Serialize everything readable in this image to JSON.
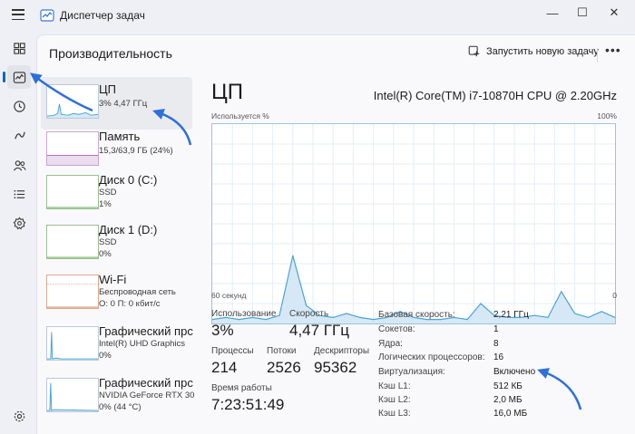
{
  "window": {
    "title": "Диспетчер задач",
    "minimize": "—",
    "maximize": "☐",
    "close": "✕"
  },
  "header": {
    "page_title": "Производительность",
    "run_task_label": "Запустить новую задачу",
    "more_label": "•••"
  },
  "nav": [
    "menu-icon",
    "processes-icon",
    "performance-icon",
    "app-history-icon",
    "startup-icon",
    "users-icon",
    "details-icon",
    "services-icon",
    "settings-icon"
  ],
  "resources": [
    {
      "name": "ЦП",
      "line1": "3% 4,47 ГГц",
      "line2": ""
    },
    {
      "name": "Память",
      "line1": "15,3/63,9 ГБ (24%)",
      "line2": ""
    },
    {
      "name": "Диск 0 (C:)",
      "line1": "SSD",
      "line2": "1%"
    },
    {
      "name": "Диск 1 (D:)",
      "line1": "SSD",
      "line2": "0%"
    },
    {
      "name": "Wi-Fi",
      "line1": "Беспроводная сеть",
      "line2": "О: 0 П: 0 кбит/с"
    },
    {
      "name": "Графический прс",
      "line1": "Intel(R) UHD Graphics",
      "line2": "0%"
    },
    {
      "name": "Графический прс",
      "line1": "NVIDIA GeForce RTX 30",
      "line2": "0% (44 °C)"
    }
  ],
  "cpu": {
    "title": "ЦП",
    "model": "Intel(R) Core(TM) i7-10870H CPU @ 2.20GHz",
    "usage_axis_label": "Используется %",
    "max_label": "100%",
    "time_label": "60 секунд",
    "min_label": "0"
  },
  "chart_data": {
    "type": "area",
    "x": [
      0,
      2,
      4,
      6,
      8,
      10,
      12,
      14,
      16,
      18,
      20,
      22,
      24,
      26,
      28,
      30,
      32,
      34,
      36,
      38,
      40,
      42,
      44,
      46,
      48,
      50,
      52,
      54,
      56,
      58,
      60
    ],
    "values": [
      2,
      3,
      2,
      3,
      2,
      4,
      34,
      9,
      4,
      3,
      5,
      3,
      2,
      3,
      6,
      3,
      2,
      2,
      3,
      2,
      10,
      4,
      3,
      3,
      4,
      3,
      16,
      5,
      3,
      6,
      3
    ],
    "ylim": [
      0,
      100
    ],
    "xlabel": "60 секунд",
    "ylabel": "Используется %",
    "grid": true,
    "line_color": "#4aa3d8",
    "fill_color": "#d6e8f5"
  },
  "stats": {
    "usage": {
      "label": "Использование",
      "value": "3%"
    },
    "speed": {
      "label": "Скорость",
      "value": "4,47 ГГц"
    },
    "processes": {
      "label": "Процессы",
      "value": "214"
    },
    "threads": {
      "label": "Потоки",
      "value": "2526"
    },
    "handles": {
      "label": "Дескрипторы",
      "value": "95362"
    },
    "uptime": {
      "label": "Время работы",
      "value": "7:23:51:49"
    }
  },
  "specs": [
    {
      "key": "Базовая скорость:",
      "value": "2,21 ГГц"
    },
    {
      "key": "Сокетов:",
      "value": "1"
    },
    {
      "key": "Ядра:",
      "value": "8"
    },
    {
      "key": "Логических процессоров:",
      "value": "16"
    },
    {
      "key": "Виртуализация:",
      "value": "Включено"
    },
    {
      "key": "Кэш L1:",
      "value": "512 КБ"
    },
    {
      "key": "Кэш L2:",
      "value": "2,0 МБ"
    },
    {
      "key": "Кэш L3:",
      "value": "16,0 МБ"
    }
  ],
  "colors": {
    "accent": "#0067c0",
    "arrow": "#2f6fd8",
    "graph_border": "#9ec1dc"
  }
}
